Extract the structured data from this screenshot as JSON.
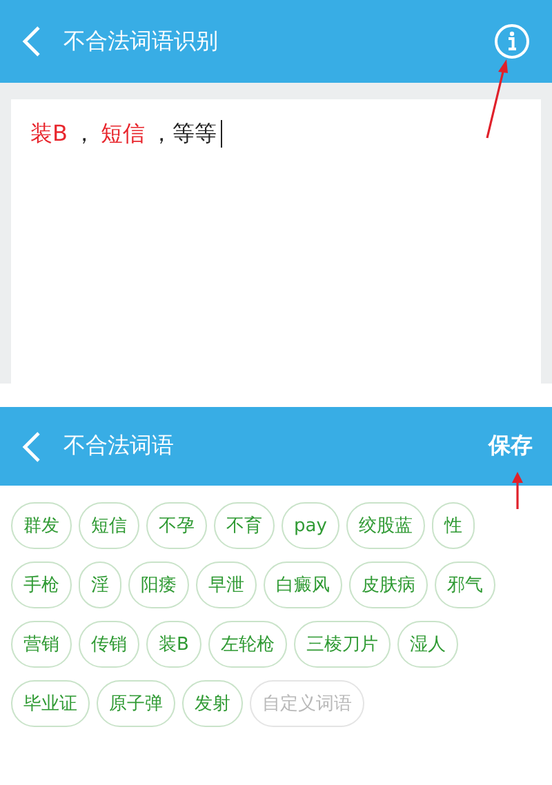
{
  "screen_1": {
    "header": {
      "title": "不合法词语识别"
    },
    "input": {
      "segments": [
        {
          "text": "装B",
          "flagged": true
        },
        {
          "text": "，",
          "flagged": false
        },
        {
          "text": "短信",
          "flagged": true
        },
        {
          "text": "，等等",
          "flagged": false
        }
      ]
    }
  },
  "screen_2": {
    "header": {
      "title": "不合法词语",
      "action": "保存"
    },
    "tags": [
      {
        "label": "群发",
        "kind": "word"
      },
      {
        "label": "短信",
        "kind": "word"
      },
      {
        "label": "不孕",
        "kind": "word"
      },
      {
        "label": "不育",
        "kind": "word"
      },
      {
        "label": "pay",
        "kind": "word"
      },
      {
        "label": "绞股蓝",
        "kind": "word"
      },
      {
        "label": "性",
        "kind": "word"
      },
      {
        "label": "手枪",
        "kind": "word"
      },
      {
        "label": "淫",
        "kind": "word"
      },
      {
        "label": "阳痿",
        "kind": "word"
      },
      {
        "label": "早泄",
        "kind": "word"
      },
      {
        "label": "白癜风",
        "kind": "word"
      },
      {
        "label": "皮肤病",
        "kind": "word"
      },
      {
        "label": "邪气",
        "kind": "word"
      },
      {
        "label": "营销",
        "kind": "word"
      },
      {
        "label": "传销",
        "kind": "word"
      },
      {
        "label": "装B",
        "kind": "word"
      },
      {
        "label": "左轮枪",
        "kind": "word"
      },
      {
        "label": "三棱刀片",
        "kind": "word"
      },
      {
        "label": "湿人",
        "kind": "word"
      },
      {
        "label": "毕业证",
        "kind": "word"
      },
      {
        "label": "原子弹",
        "kind": "word"
      },
      {
        "label": "发射",
        "kind": "word"
      },
      {
        "label": "自定义词语",
        "kind": "custom"
      }
    ]
  }
}
